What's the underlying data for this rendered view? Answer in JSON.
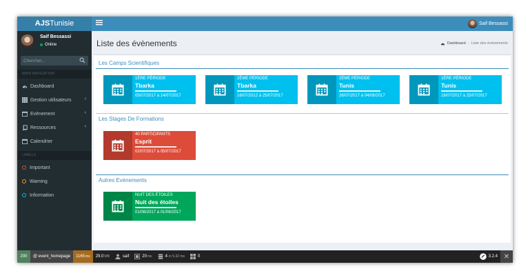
{
  "brand": {
    "bold": "AJS",
    "rest": "Tunisie"
  },
  "topbar": {
    "user_name": "Saif Bessassi"
  },
  "sidebar": {
    "user": {
      "name": "Saif Bessassi",
      "status": "Online"
    },
    "search_placeholder": "Chercher...",
    "main_header": "MAIN NAVIGATION",
    "items": [
      {
        "label": "Dashboard",
        "icon": "dashboard-icon"
      },
      {
        "label": "Gestion utilisateurs",
        "icon": "grid-icon"
      },
      {
        "label": "Evènement",
        "icon": "calendar-icon"
      },
      {
        "label": "Ressources",
        "icon": "book-icon"
      },
      {
        "label": "Calendrier",
        "icon": "calendar-icon"
      }
    ],
    "labels_header": "LABELS",
    "labels": [
      {
        "label": "Important",
        "color": "#dd4b39"
      },
      {
        "label": "Warning",
        "color": "#f39c12"
      },
      {
        "label": "Information",
        "color": "#00c0ef"
      }
    ]
  },
  "page": {
    "title": "Liste des évènements",
    "breadcrumb": [
      "Dashboard",
      "Liste des évènements"
    ]
  },
  "sections": {
    "camps": {
      "title": "Les Camps Scientifiques",
      "cards": [
        {
          "period": "1ÈRE PÉRIODE",
          "place": "Tbarka",
          "dates": "05/07/2017 à 14/07/2017"
        },
        {
          "period": "2ÈME PÉRIODE",
          "place": "Tbarka",
          "dates": "16/07/2012 à 25/07/2017"
        },
        {
          "period": "2ÈME PÉRIODE",
          "place": "Tunis",
          "dates": "26/07/2017 à 04/08/2017"
        },
        {
          "period": "1ÈRE PÉRIODE",
          "place": "Tunis",
          "dates": "16/07/2017 à 25/07/2017"
        }
      ]
    },
    "stages": {
      "title": "Les Stages De Formations",
      "cards": [
        {
          "period": "40 PARTICIPANTS",
          "place": "Esprit",
          "dates": "02/07/2017 à 05/07/2017"
        }
      ]
    },
    "autres": {
      "title": "Autres Evènements",
      "cards": [
        {
          "period": "NUIT DES ÉTOILES",
          "place": "Nuit des étoiles",
          "dates": "01/08/2017 à 01/08/2017"
        }
      ]
    }
  },
  "colors": {
    "camp": "#00c0ef",
    "camp_dark": "#0097bc",
    "stage": "#dd4b39",
    "stage_dark": "#b33a2c",
    "other": "#00a65a",
    "other_dark": "#008548"
  },
  "debugbar": {
    "status": "200",
    "route": "@ event_homepage",
    "time": "1165",
    "time_unit": "ms",
    "memory": "29.0",
    "memory_unit": "MB",
    "user": "saif",
    "render_time": "20",
    "render_unit": "ms",
    "db_queries": "4",
    "db_time": "in 5.32 ms",
    "twig": "0",
    "version": "3.2.4"
  }
}
